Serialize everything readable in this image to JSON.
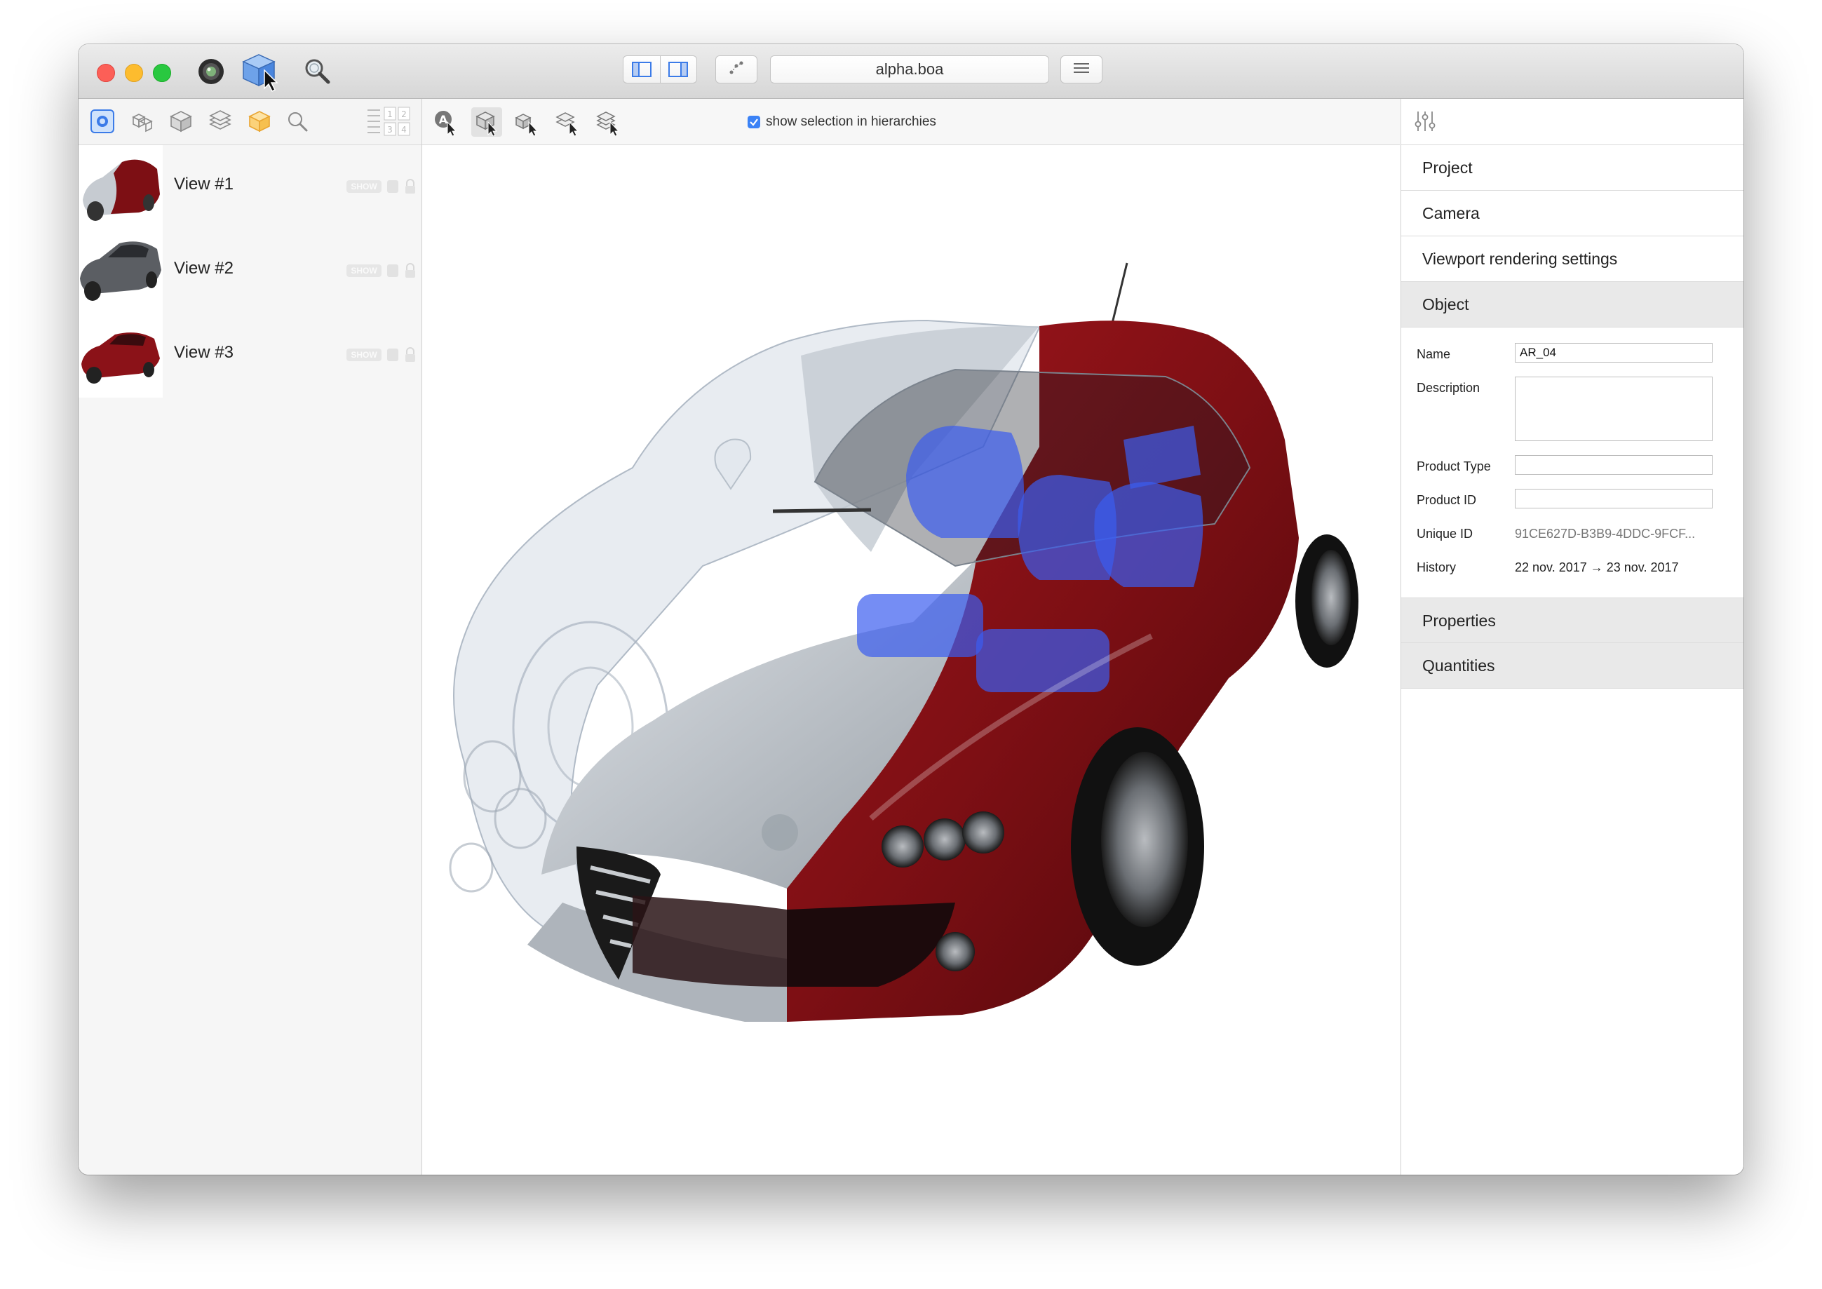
{
  "window": {
    "title": "alpha.boa"
  },
  "toolbar": {
    "icons": [
      "camera-lens-icon",
      "select-cube-icon",
      "inspect-magnifier-icon"
    ],
    "buttons": [
      "left-panel-toggle-icon",
      "right-panel-toggle-icon",
      "graph-icon",
      "list-icon"
    ]
  },
  "left_panel": {
    "tabs": [
      "views-icon",
      "objects-icon",
      "materials-icon",
      "layers-icon",
      "box-icon",
      "search-icon"
    ],
    "numbers": [
      "1",
      "2",
      "3",
      "4"
    ],
    "views": [
      {
        "label": "View #1",
        "badge": "SHOW"
      },
      {
        "label": "View #2",
        "badge": "SHOW"
      },
      {
        "label": "View #3",
        "badge": "SHOW"
      }
    ]
  },
  "center": {
    "tools": [
      "annotate-icon",
      "select-object-icon",
      "select-group-icon",
      "select-layer-icon",
      "select-hierarchy-icon"
    ],
    "checkbox": {
      "label": "show selection in hierarchies",
      "checked": true
    }
  },
  "inspector": {
    "icon": "sliders-icon",
    "sections": [
      "Project",
      "Camera",
      "Viewport rendering settings",
      "Object"
    ],
    "fields": {
      "name_label": "Name",
      "name_value": "AR_04",
      "description_label": "Description",
      "description_value": "",
      "product_type_label": "Product Type",
      "product_type_value": "",
      "product_id_label": "Product ID",
      "product_id_value": "",
      "unique_id_label": "Unique ID",
      "unique_id_value": "91CE627D-B3B9-4DDC-9FCF...",
      "history_label": "History",
      "history_value": "22 nov. 2017 → 23 nov. 2017"
    },
    "bottom_sections": [
      "Properties",
      "Quantities"
    ]
  },
  "colors": {
    "car_red": "#7d0f14",
    "car_silver": "#b9bec4",
    "seat_blue": "#3b5cf0",
    "accent": "#3b82f6"
  }
}
